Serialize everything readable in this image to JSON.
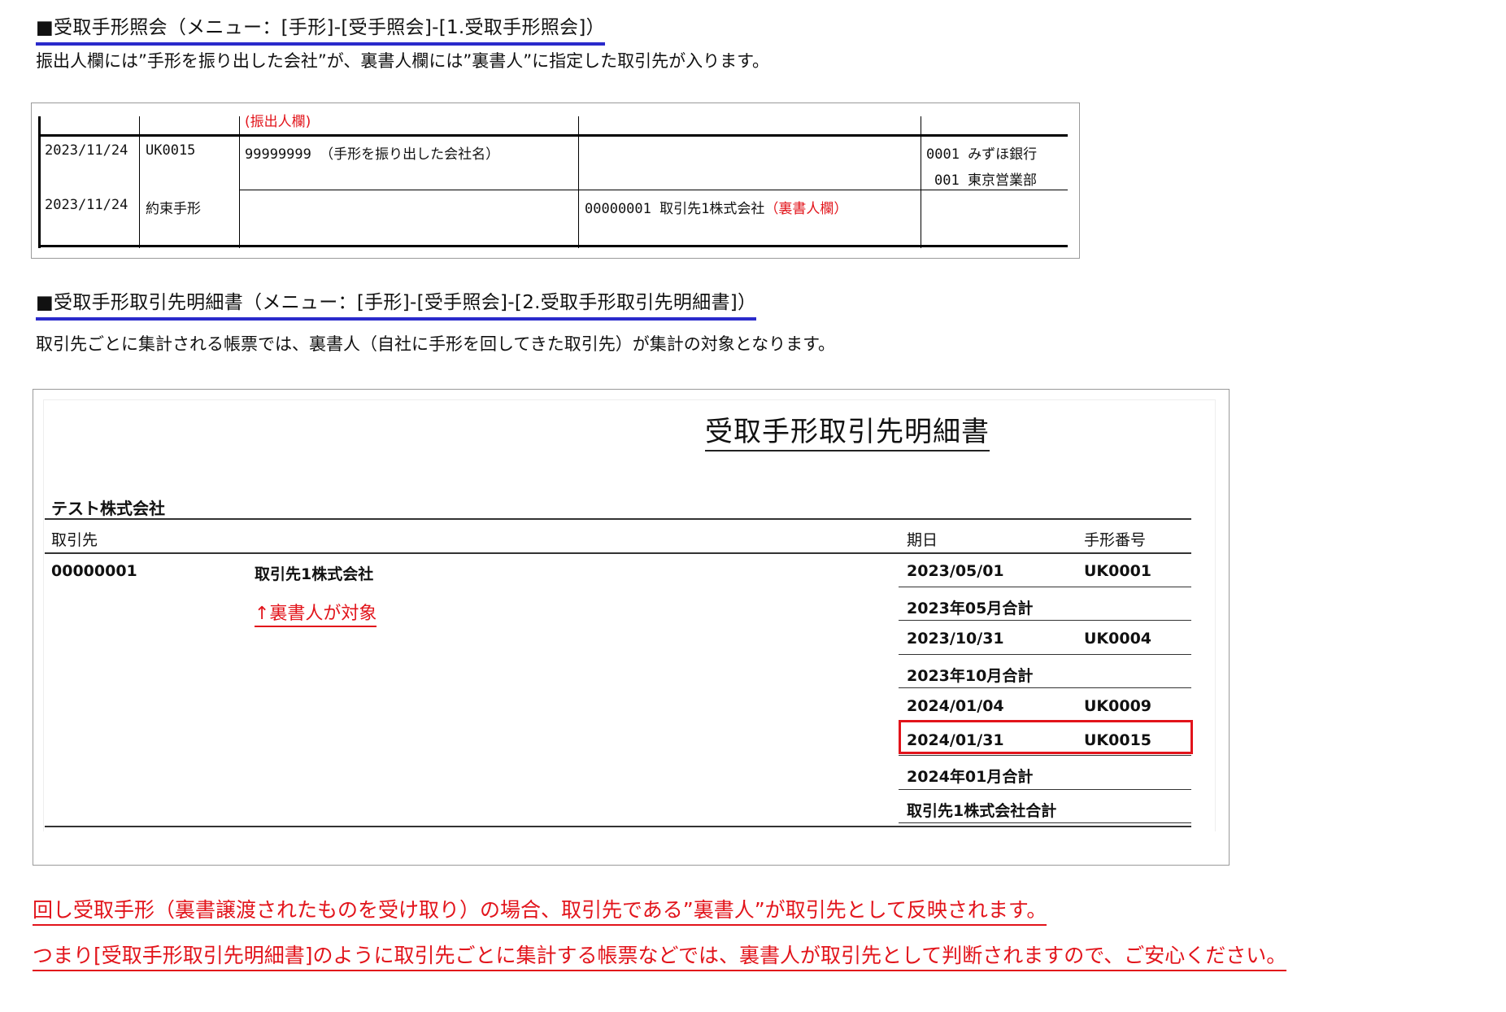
{
  "section1": {
    "heading": "■受取手形照会（メニュー：[手形]-[受手照会]-[1.受取手形照会]）",
    "description": "振出人欄には”手形を振り出した会社”が、裏書人欄には”裏書人”に指定した取引先が入ります。",
    "table": {
      "header_note": "(振出人欄)",
      "row1": {
        "date": "2023/11/24",
        "code": "UK0015",
        "drawer": "99999999 （手形を振り出した会社名）",
        "bank_line1": "0001 みずほ銀行",
        "bank_line2": "001 東京営業部"
      },
      "row2": {
        "date": "2023/11/24",
        "type": "約束手形",
        "endorser": "00000001 取引先1株式会社",
        "endorser_note": "（裏書人欄）"
      }
    }
  },
  "section2": {
    "heading": "■受取手形取引先明細書（メニュー：[手形]-[受手照会]-[2.受取手形取引先明細書]）",
    "description": "取引先ごとに集計される帳票では、裏書人（自社に手形を回してきた取引先）が集計の対象となります。",
    "report": {
      "title": "受取手形取引先明細書",
      "company": "テスト株式会社",
      "col_partner": "取引先",
      "col_due": "期日",
      "col_bill_no": "手形番号",
      "partner_code": "00000001",
      "partner_name": "取引先1株式会社",
      "annotation": "↑裏書人が対象",
      "rows": [
        {
          "date": "2023/05/01",
          "no": "UK0001"
        },
        {
          "date": "2023年05月合計",
          "no": ""
        },
        {
          "date": "2023/10/31",
          "no": "UK0004"
        },
        {
          "date": "2023年10月合計",
          "no": ""
        },
        {
          "date": "2024/01/04",
          "no": "UK0009"
        },
        {
          "date": "2024/01/31",
          "no": "UK0015"
        },
        {
          "date": "2024年01月合計",
          "no": ""
        },
        {
          "date": "取引先1株式会社合計",
          "no": ""
        }
      ],
      "highlight_color": "#e2141b"
    }
  },
  "notes": {
    "line1": "回し受取手形（裏書譲渡されたものを受け取り）の場合、取引先である”裏書人”が取引先として反映されます。",
    "line2": "つまり[受取手形取引先明細書]のように取引先ごとに集計する帳票などでは、裏書人が取引先として判断されますので、ご安心ください。"
  }
}
